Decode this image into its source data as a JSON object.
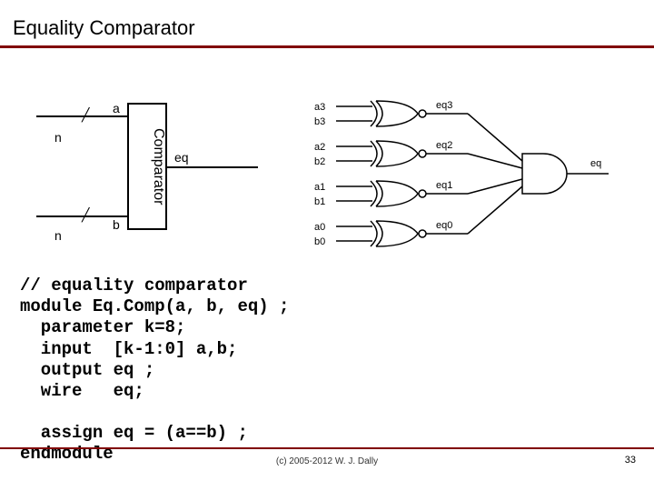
{
  "title": "Equality Comparator",
  "block": {
    "comparator_label": "Comparator",
    "input_a": "a",
    "input_b": "b",
    "output_eq": "eq",
    "width_a": "n",
    "width_b": "n"
  },
  "schematic": {
    "xnor_gates": [
      {
        "in1": "a3",
        "in2": "b3",
        "out": "eq3"
      },
      {
        "in1": "a2",
        "in2": "b2",
        "out": "eq2"
      },
      {
        "in1": "a1",
        "in2": "b1",
        "out": "eq1"
      },
      {
        "in1": "a0",
        "in2": "b0",
        "out": "eq0"
      }
    ],
    "and_output": "eq"
  },
  "code": {
    "l1": "// equality comparator",
    "l2": "module Eq.Comp(a, b, eq) ;",
    "l3": "  parameter k=8;",
    "l4": "  input  [k-1:0] a,b;",
    "l5": "  output eq ;",
    "l6": "  wire   eq;",
    "l7": "",
    "l8": "  assign eq = (a==b) ;",
    "l9": "endmodule"
  },
  "footer": {
    "copyright": "(c) 2005-2012 W. J. Dally",
    "page": "33"
  }
}
